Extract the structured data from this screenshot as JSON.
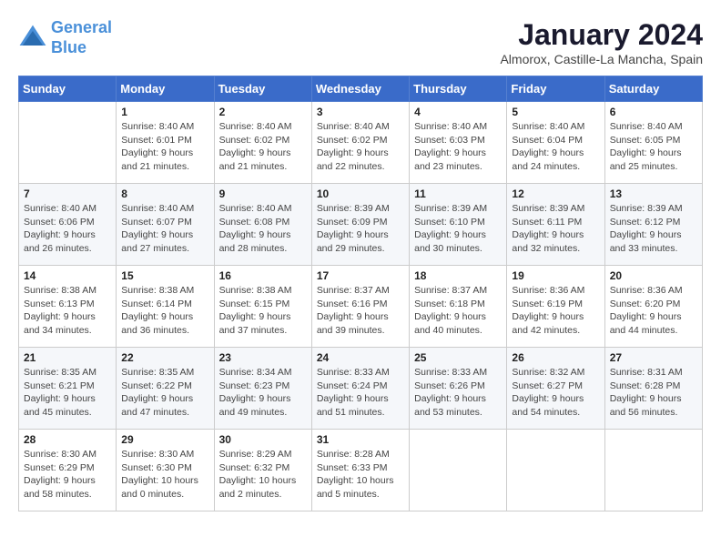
{
  "header": {
    "logo_line1": "General",
    "logo_line2": "Blue",
    "month": "January 2024",
    "location": "Almorox, Castille-La Mancha, Spain"
  },
  "days_of_week": [
    "Sunday",
    "Monday",
    "Tuesday",
    "Wednesday",
    "Thursday",
    "Friday",
    "Saturday"
  ],
  "weeks": [
    [
      {
        "day": "",
        "sunrise": "",
        "sunset": "",
        "daylight": ""
      },
      {
        "day": "1",
        "sunrise": "Sunrise: 8:40 AM",
        "sunset": "Sunset: 6:01 PM",
        "daylight": "Daylight: 9 hours and 21 minutes."
      },
      {
        "day": "2",
        "sunrise": "Sunrise: 8:40 AM",
        "sunset": "Sunset: 6:02 PM",
        "daylight": "Daylight: 9 hours and 21 minutes."
      },
      {
        "day": "3",
        "sunrise": "Sunrise: 8:40 AM",
        "sunset": "Sunset: 6:02 PM",
        "daylight": "Daylight: 9 hours and 22 minutes."
      },
      {
        "day": "4",
        "sunrise": "Sunrise: 8:40 AM",
        "sunset": "Sunset: 6:03 PM",
        "daylight": "Daylight: 9 hours and 23 minutes."
      },
      {
        "day": "5",
        "sunrise": "Sunrise: 8:40 AM",
        "sunset": "Sunset: 6:04 PM",
        "daylight": "Daylight: 9 hours and 24 minutes."
      },
      {
        "day": "6",
        "sunrise": "Sunrise: 8:40 AM",
        "sunset": "Sunset: 6:05 PM",
        "daylight": "Daylight: 9 hours and 25 minutes."
      }
    ],
    [
      {
        "day": "7",
        "sunrise": "Sunrise: 8:40 AM",
        "sunset": "Sunset: 6:06 PM",
        "daylight": "Daylight: 9 hours and 26 minutes."
      },
      {
        "day": "8",
        "sunrise": "Sunrise: 8:40 AM",
        "sunset": "Sunset: 6:07 PM",
        "daylight": "Daylight: 9 hours and 27 minutes."
      },
      {
        "day": "9",
        "sunrise": "Sunrise: 8:40 AM",
        "sunset": "Sunset: 6:08 PM",
        "daylight": "Daylight: 9 hours and 28 minutes."
      },
      {
        "day": "10",
        "sunrise": "Sunrise: 8:39 AM",
        "sunset": "Sunset: 6:09 PM",
        "daylight": "Daylight: 9 hours and 29 minutes."
      },
      {
        "day": "11",
        "sunrise": "Sunrise: 8:39 AM",
        "sunset": "Sunset: 6:10 PM",
        "daylight": "Daylight: 9 hours and 30 minutes."
      },
      {
        "day": "12",
        "sunrise": "Sunrise: 8:39 AM",
        "sunset": "Sunset: 6:11 PM",
        "daylight": "Daylight: 9 hours and 32 minutes."
      },
      {
        "day": "13",
        "sunrise": "Sunrise: 8:39 AM",
        "sunset": "Sunset: 6:12 PM",
        "daylight": "Daylight: 9 hours and 33 minutes."
      }
    ],
    [
      {
        "day": "14",
        "sunrise": "Sunrise: 8:38 AM",
        "sunset": "Sunset: 6:13 PM",
        "daylight": "Daylight: 9 hours and 34 minutes."
      },
      {
        "day": "15",
        "sunrise": "Sunrise: 8:38 AM",
        "sunset": "Sunset: 6:14 PM",
        "daylight": "Daylight: 9 hours and 36 minutes."
      },
      {
        "day": "16",
        "sunrise": "Sunrise: 8:38 AM",
        "sunset": "Sunset: 6:15 PM",
        "daylight": "Daylight: 9 hours and 37 minutes."
      },
      {
        "day": "17",
        "sunrise": "Sunrise: 8:37 AM",
        "sunset": "Sunset: 6:16 PM",
        "daylight": "Daylight: 9 hours and 39 minutes."
      },
      {
        "day": "18",
        "sunrise": "Sunrise: 8:37 AM",
        "sunset": "Sunset: 6:18 PM",
        "daylight": "Daylight: 9 hours and 40 minutes."
      },
      {
        "day": "19",
        "sunrise": "Sunrise: 8:36 AM",
        "sunset": "Sunset: 6:19 PM",
        "daylight": "Daylight: 9 hours and 42 minutes."
      },
      {
        "day": "20",
        "sunrise": "Sunrise: 8:36 AM",
        "sunset": "Sunset: 6:20 PM",
        "daylight": "Daylight: 9 hours and 44 minutes."
      }
    ],
    [
      {
        "day": "21",
        "sunrise": "Sunrise: 8:35 AM",
        "sunset": "Sunset: 6:21 PM",
        "daylight": "Daylight: 9 hours and 45 minutes."
      },
      {
        "day": "22",
        "sunrise": "Sunrise: 8:35 AM",
        "sunset": "Sunset: 6:22 PM",
        "daylight": "Daylight: 9 hours and 47 minutes."
      },
      {
        "day": "23",
        "sunrise": "Sunrise: 8:34 AM",
        "sunset": "Sunset: 6:23 PM",
        "daylight": "Daylight: 9 hours and 49 minutes."
      },
      {
        "day": "24",
        "sunrise": "Sunrise: 8:33 AM",
        "sunset": "Sunset: 6:24 PM",
        "daylight": "Daylight: 9 hours and 51 minutes."
      },
      {
        "day": "25",
        "sunrise": "Sunrise: 8:33 AM",
        "sunset": "Sunset: 6:26 PM",
        "daylight": "Daylight: 9 hours and 53 minutes."
      },
      {
        "day": "26",
        "sunrise": "Sunrise: 8:32 AM",
        "sunset": "Sunset: 6:27 PM",
        "daylight": "Daylight: 9 hours and 54 minutes."
      },
      {
        "day": "27",
        "sunrise": "Sunrise: 8:31 AM",
        "sunset": "Sunset: 6:28 PM",
        "daylight": "Daylight: 9 hours and 56 minutes."
      }
    ],
    [
      {
        "day": "28",
        "sunrise": "Sunrise: 8:30 AM",
        "sunset": "Sunset: 6:29 PM",
        "daylight": "Daylight: 9 hours and 58 minutes."
      },
      {
        "day": "29",
        "sunrise": "Sunrise: 8:30 AM",
        "sunset": "Sunset: 6:30 PM",
        "daylight": "Daylight: 10 hours and 0 minutes."
      },
      {
        "day": "30",
        "sunrise": "Sunrise: 8:29 AM",
        "sunset": "Sunset: 6:32 PM",
        "daylight": "Daylight: 10 hours and 2 minutes."
      },
      {
        "day": "31",
        "sunrise": "Sunrise: 8:28 AM",
        "sunset": "Sunset: 6:33 PM",
        "daylight": "Daylight: 10 hours and 5 minutes."
      },
      {
        "day": "",
        "sunrise": "",
        "sunset": "",
        "daylight": ""
      },
      {
        "day": "",
        "sunrise": "",
        "sunset": "",
        "daylight": ""
      },
      {
        "day": "",
        "sunrise": "",
        "sunset": "",
        "daylight": ""
      }
    ]
  ]
}
